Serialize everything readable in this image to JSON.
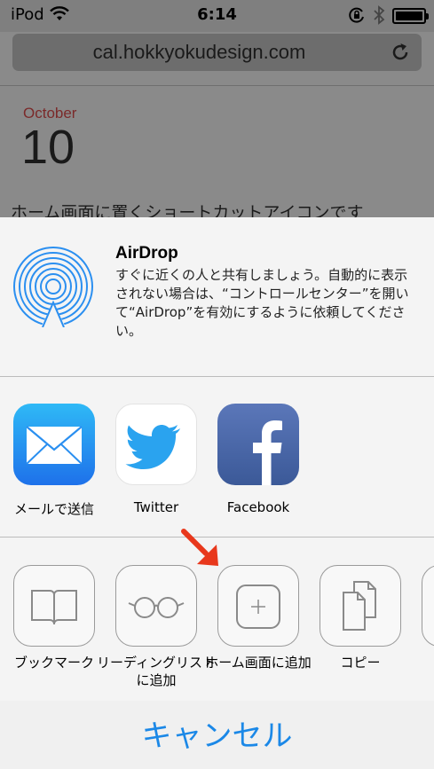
{
  "status_bar": {
    "carrier": "iPod",
    "time": "6:14",
    "icons": [
      "wifi-icon",
      "rotation-lock-icon",
      "bluetooth-icon",
      "battery-icon"
    ]
  },
  "browser": {
    "url": "cal.hokkyokudesign.com",
    "reload_icon": "reload-icon"
  },
  "page": {
    "month": "October",
    "day": "10",
    "headline": "ホーム画面に置くショートカットアイコンです"
  },
  "share_sheet": {
    "airdrop": {
      "title": "AirDrop",
      "description": "すぐに近くの人と共有しましょう。自動的に表示されない場合は、“コントロールセンター”を開いて“AirDrop”を有効にするように依頼してください。"
    },
    "apps": [
      {
        "label": "メールで送信",
        "icon": "mail-icon"
      },
      {
        "label": "Twitter",
        "icon": "twitter-icon"
      },
      {
        "label": "Facebook",
        "icon": "facebook-icon"
      }
    ],
    "actions": [
      {
        "label": "ブックマーク",
        "icon": "bookmark-icon"
      },
      {
        "label": "リーディングリストに追加",
        "icon": "reading-list-icon"
      },
      {
        "label": "ホーム画面に追加",
        "icon": "add-to-home-icon"
      },
      {
        "label": "コピー",
        "icon": "copy-icon"
      }
    ],
    "cancel_label": "キャンセル"
  },
  "colors": {
    "accent": "#1b88e7",
    "annotation_arrow": "#e8381c",
    "month_text": "#7b2a2a"
  }
}
